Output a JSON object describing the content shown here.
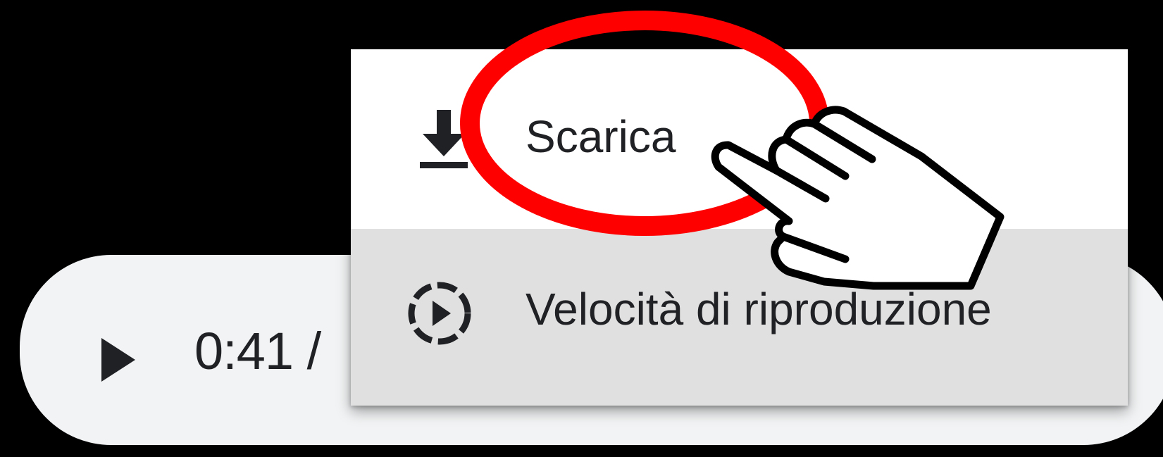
{
  "player": {
    "current_time": "0:41 /",
    "play_icon": "play-icon"
  },
  "menu": {
    "items": [
      {
        "label": "Scarica",
        "icon": "download-icon"
      },
      {
        "label": "Velocità di riproduzione",
        "icon": "playback-speed-icon"
      }
    ]
  },
  "annotation": {
    "highlight_color": "#ff0000",
    "cursor_icon": "hand-pointer-icon"
  },
  "colors": {
    "background": "#000000",
    "player_bg": "#f1f3f4",
    "menu_bg": "#ffffff",
    "menu_hover_bg": "#e0e0e0",
    "text": "#202124"
  }
}
